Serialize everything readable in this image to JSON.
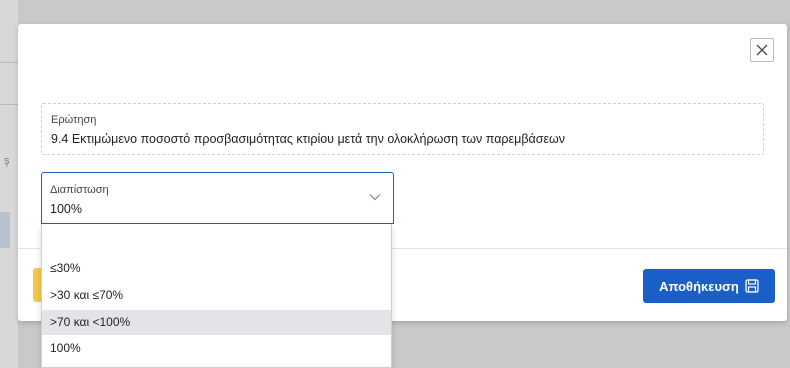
{
  "dialog": {
    "question": {
      "label": "Ερώτηση",
      "text": "9.4 Εκτιμώμενο ποσοστό προσβασιμότητας κτιρίου μετά την ολοκλήρωση των παρεμβάσεων"
    },
    "finding": {
      "label": "Διαπίστωση",
      "value": "100%"
    },
    "dropdown": {
      "options": [
        "",
        "≤30%",
        ">30 και ≤70%",
        ">70 και <100%",
        "100%"
      ],
      "highlighted": ">70 και <100%"
    },
    "save_button_label": "Αποθήκευση",
    "icons": {
      "close": "close-icon",
      "chevron": "chevron-down-icon",
      "save": "save-icon"
    },
    "colors": {
      "primary": "#1a5fc8",
      "focus_border": "#1f5fb6",
      "warning": "#f2c94c",
      "highlight": "#e4e4e8"
    }
  }
}
